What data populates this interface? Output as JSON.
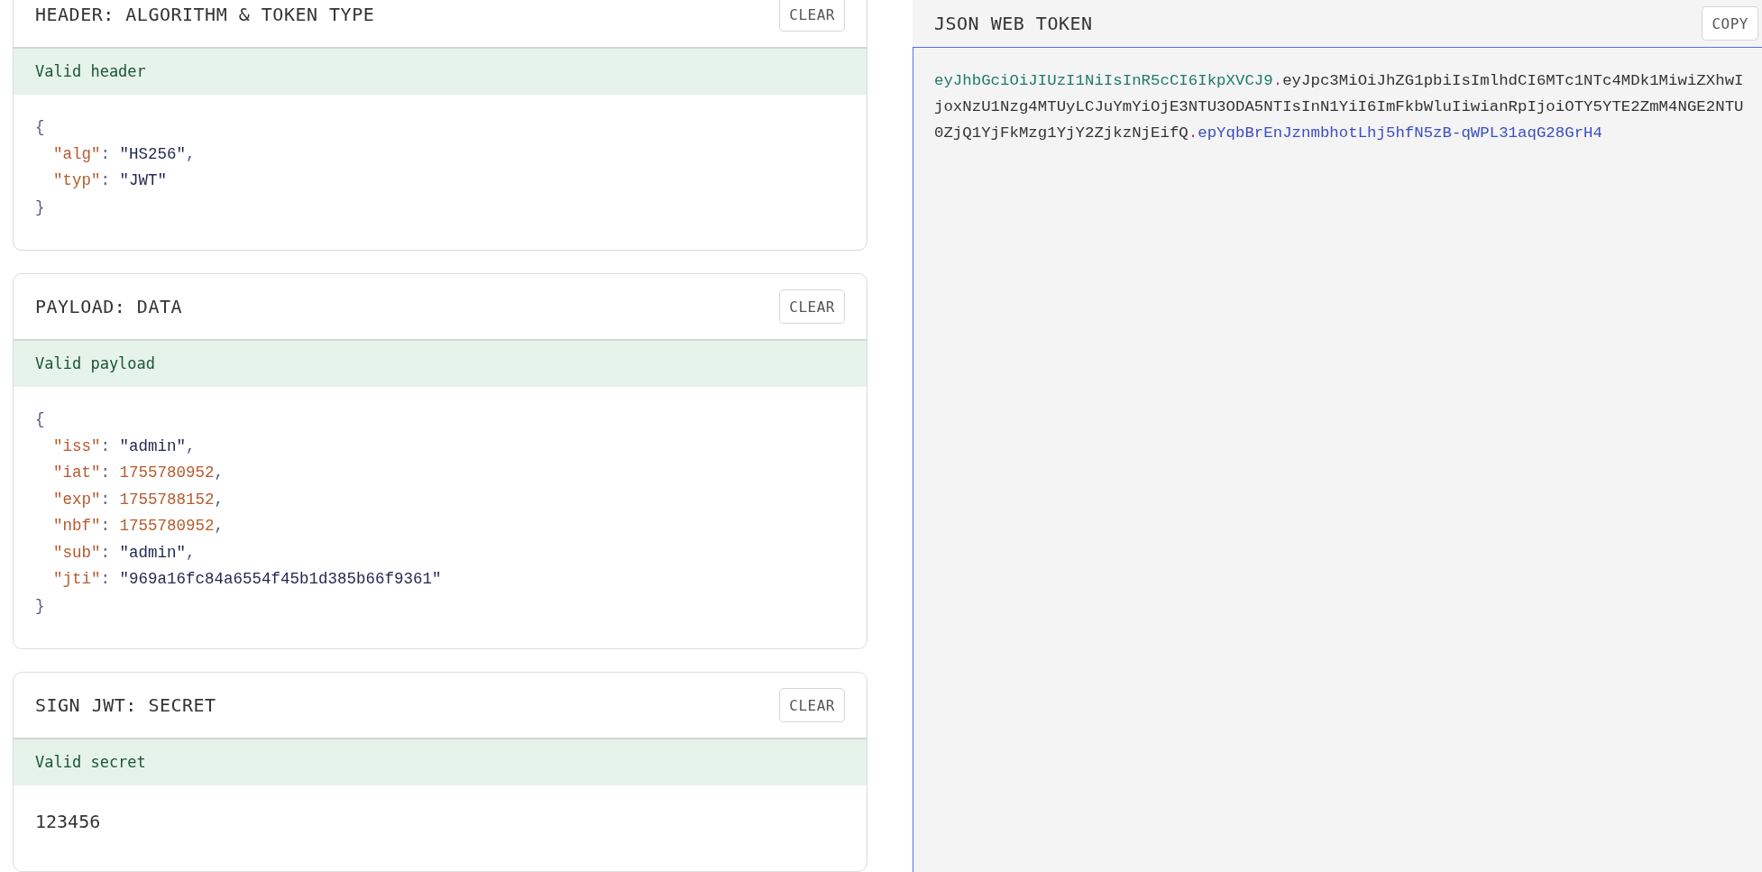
{
  "sections": [
    {
      "title": "HEADER: ALGORITHM & TOKEN TYPE",
      "button": "CLEAR",
      "status": "Valid header",
      "kind": "json",
      "open": "{",
      "close": "}",
      "lines": [
        {
          "key": "\"alg\"",
          "colon": ":",
          "value": "\"HS256\"",
          "kind": "string",
          "comma": ","
        },
        {
          "key": "\"typ\"",
          "colon": ":",
          "value": "\"JWT\"",
          "kind": "string"
        }
      ]
    },
    {
      "title": "PAYLOAD: DATA",
      "button": "CLEAR",
      "status": "Valid payload",
      "kind": "json",
      "open": "{",
      "close": "}",
      "lines": [
        {
          "key": "\"iss\"",
          "colon": ":",
          "value": "\"admin\"",
          "kind": "string",
          "comma": ","
        },
        {
          "key": "\"iat\"",
          "colon": ":",
          "value": "1755780952",
          "kind": "number",
          "comma": ","
        },
        {
          "key": "\"exp\"",
          "colon": ":",
          "value": "1755788152",
          "kind": "number",
          "comma": ","
        },
        {
          "key": "\"nbf\"",
          "colon": ":",
          "value": "1755780952",
          "kind": "number",
          "comma": ","
        },
        {
          "key": "\"sub\"",
          "colon": ":",
          "value": "\"admin\"",
          "kind": "string",
          "comma": ","
        },
        {
          "key": "\"jti\"",
          "colon": ":",
          "value": "\"969a16fc84a6554f45b1d385b66f9361\"",
          "kind": "string"
        }
      ]
    },
    {
      "title": "SIGN JWT: SECRET",
      "button": "CLEAR",
      "status": "Valid secret",
      "kind": "secret",
      "value": "123456"
    }
  ],
  "token": {
    "title": "JSON WEB TOKEN",
    "button": "COPY",
    "parts": [
      {
        "kind": "header",
        "text": "eyJhbGciOiJIUzI1NiIsInR5cCI6IkpXVCJ9"
      },
      {
        "kind": "dot",
        "text": "."
      },
      {
        "kind": "payload",
        "text": "eyJpc3MiOiJhZG1pbiIsImlhdCI6MTc1NTc4MDk1MiwiZXhwIjoxNzU1Nzg4MTUyLCJuYmYiOjE3NTU3ODA5NTIsInN1YiI6ImFkbWluIiwianRpIjoiOTY5YTE2ZmM4NGE2NTU0ZjQ1YjFkMzg1YjY2ZjkzNjEifQ"
      },
      {
        "kind": "dot",
        "text": "."
      },
      {
        "kind": "signature",
        "text": "epYqbBrEnJznmbhotLhj5hfN5zB-qWPL31aqG28GrH4"
      }
    ]
  }
}
